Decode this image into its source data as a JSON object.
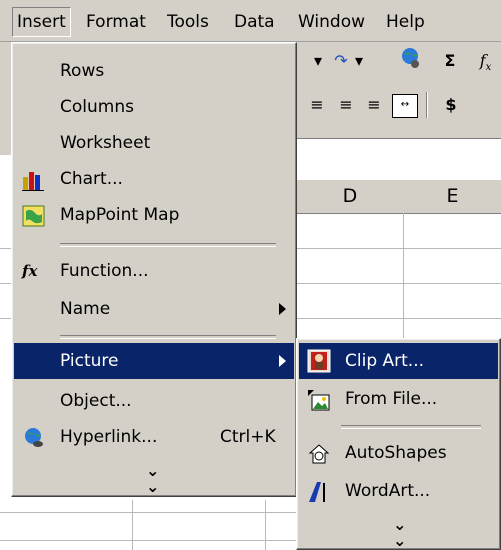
{
  "menubar": {
    "items": [
      {
        "label": "Insert"
      },
      {
        "label": "Format"
      },
      {
        "label": "Tools"
      },
      {
        "label": "Data"
      },
      {
        "label": "Window"
      },
      {
        "label": "Help"
      }
    ]
  },
  "toolbar": {
    "sigma": "Σ",
    "currency": "$"
  },
  "sheet": {
    "columns": [
      "D",
      "E"
    ]
  },
  "insert_menu": {
    "items": [
      {
        "label": "Rows"
      },
      {
        "label": "Columns"
      },
      {
        "label": "Worksheet"
      },
      {
        "label": "Chart...",
        "icon": "chart-icon"
      },
      {
        "label": "MapPoint Map",
        "icon": "map-icon"
      },
      {
        "label": "Function...",
        "icon": "function-icon"
      },
      {
        "label": "Name",
        "submenu": true
      },
      {
        "label": "Picture",
        "submenu": true,
        "selected": true
      },
      {
        "label": "Object..."
      },
      {
        "label": "Hyperlink...",
        "shortcut": "Ctrl+K",
        "icon": "globe-icon"
      }
    ],
    "function_glyph": "fx"
  },
  "picture_menu": {
    "items": [
      {
        "label": "Clip Art...",
        "icon": "clipart-icon",
        "selected": true
      },
      {
        "label": "From File...",
        "icon": "picture-file-icon"
      },
      {
        "label": "AutoShapes",
        "icon": "autoshapes-icon"
      },
      {
        "label": "WordArt...",
        "icon": "wordart-icon"
      }
    ]
  },
  "colors": {
    "menu_bg": "#d4d0c8",
    "selection": "#0a246a",
    "window_bg": "#ffffff"
  }
}
